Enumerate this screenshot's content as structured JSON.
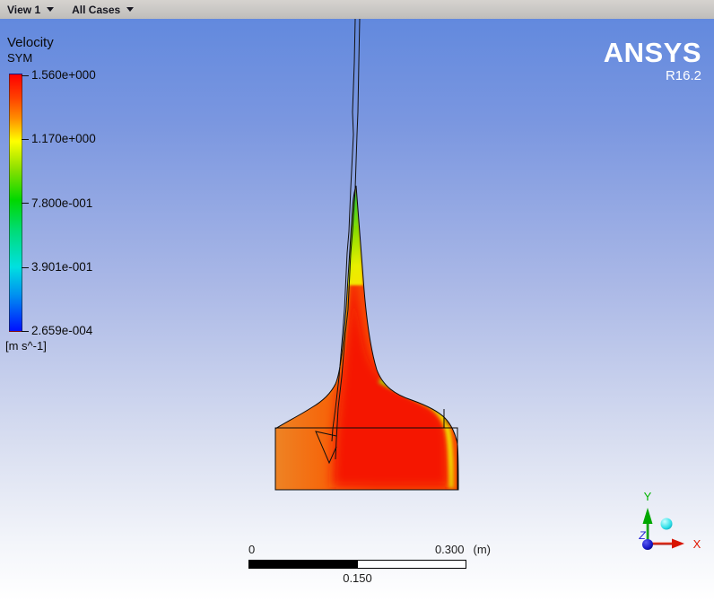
{
  "toolbar": {
    "view_label": "View 1",
    "cases_label": "All Cases"
  },
  "branding": {
    "app_name": "ANSYS",
    "version": "R16.2"
  },
  "legend": {
    "title": "Velocity",
    "subtitle": "SYM",
    "unit": "[m s^-1]",
    "ticks": [
      "1.560e+000",
      "1.170e+000",
      "7.800e-001",
      "3.901e-001",
      "2.659e-004"
    ],
    "colormap": "rainbow",
    "colors": {
      "max": "#ff0000",
      "high": "#ffff00",
      "mid": "#00d800",
      "low": "#00e0e0",
      "min": "#0010ff"
    }
  },
  "ruler": {
    "left_label": "0",
    "right_label": "0.300",
    "unit_label": "(m)",
    "mid_label": "0.150"
  },
  "triad": {
    "x_label": "X",
    "y_label": "Y",
    "z_label": "Z",
    "x_color": "#e01800",
    "y_color": "#00b400",
    "z_color": "#1e1ed2"
  },
  "chart_data": {
    "type": "heatmap",
    "subtype": "cfd-velocity-contour",
    "title": "Velocity",
    "location": "SYM",
    "unit": "m s^-1",
    "value_min": 0.0002659,
    "value_max": 1.56,
    "legend_levels": [
      1.56,
      1.17,
      0.78,
      0.3901,
      0.0002659
    ],
    "colormap": "rainbow",
    "scale_bar_m": {
      "min": 0,
      "mid": 0.15,
      "max": 0.3
    },
    "description": "Narrow vertical jet plume (green/yellow edges, red core) rising from an orange rectangular liquid domain; thin wireframe nozzle lines descend from top into the plume; yellow shear streak curves down the right side."
  }
}
